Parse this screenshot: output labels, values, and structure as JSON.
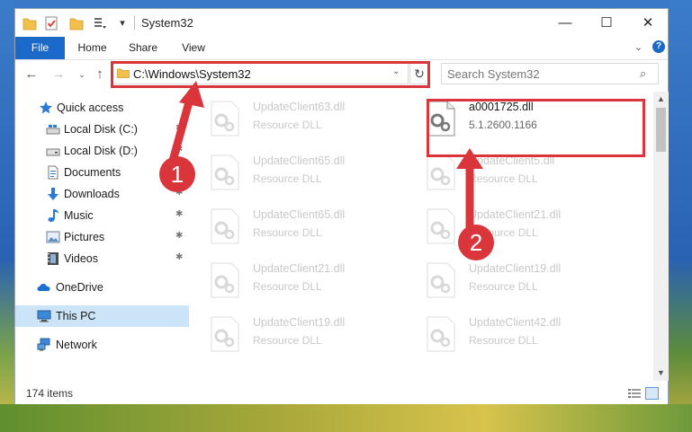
{
  "window": {
    "title": "System32",
    "controls": {
      "minimize": "—",
      "maximize": "☐",
      "close": "✕"
    }
  },
  "ribbon": {
    "tabs": [
      "File",
      "Home",
      "Share",
      "View"
    ],
    "expand_glyph": "⌄",
    "help_glyph": "?"
  },
  "nav": {
    "back": "←",
    "forward": "→",
    "recent": "⌄",
    "up": "↑",
    "address": "C:\\Windows\\System32",
    "address_dropdown": "⌄",
    "refresh": "↻",
    "search_placeholder": "Search System32",
    "search_glyph": "⌕"
  },
  "sidebar": {
    "items": [
      {
        "label": "Quick access",
        "icon": "star-icon",
        "pinned": false
      },
      {
        "label": "Local Disk (C:)",
        "icon": "drive-icon",
        "pinned": true
      },
      {
        "label": "Local Disk (D:)",
        "icon": "drive-icon",
        "pinned": true
      },
      {
        "label": "Documents",
        "icon": "documents-icon",
        "pinned": true
      },
      {
        "label": "Downloads",
        "icon": "download-icon",
        "pinned": true
      },
      {
        "label": "Music",
        "icon": "music-icon",
        "pinned": true
      },
      {
        "label": "Pictures",
        "icon": "pictures-icon",
        "pinned": true
      },
      {
        "label": "Videos",
        "icon": "videos-icon",
        "pinned": true
      },
      {
        "label": "OneDrive",
        "icon": "cloud-icon",
        "pinned": false
      },
      {
        "label": "This PC",
        "icon": "pc-icon",
        "pinned": false,
        "selected": true
      },
      {
        "label": "Network",
        "icon": "network-icon",
        "pinned": false
      }
    ],
    "pin_glyph": "📌"
  },
  "files": [
    {
      "name": "UpdateClient63.dll",
      "type": "Resource DLL",
      "faded": true
    },
    {
      "name": "a0001725.dll",
      "type": "5.1.2600.1166",
      "faded": false
    },
    {
      "name": "UpdateClient65.dll",
      "type": "Resource DLL",
      "faded": true
    },
    {
      "name": "UpdateClient5.dll",
      "type": "Resource DLL",
      "faded": true
    },
    {
      "name": "UpdateClient65.dll",
      "type": "Resource DLL",
      "faded": true
    },
    {
      "name": "UpdateClient21.dll",
      "type": "Resource DLL",
      "faded": true
    },
    {
      "name": "UpdateClient21.dll",
      "type": "Resource DLL",
      "faded": true
    },
    {
      "name": "UpdateClient19.dll",
      "type": "Resource DLL",
      "faded": true
    },
    {
      "name": "UpdateClient19.dll",
      "type": "Resource DLL",
      "faded": true
    },
    {
      "name": "UpdateClient42.dll",
      "type": "Resource DLL",
      "faded": true
    }
  ],
  "status": {
    "item_count": "174 items"
  },
  "annotations": {
    "step1": "1",
    "step2": "2",
    "highlight_color": "#d9353b"
  },
  "colors": {
    "accent": "#1b6ac9",
    "selection": "#cce4f7"
  }
}
